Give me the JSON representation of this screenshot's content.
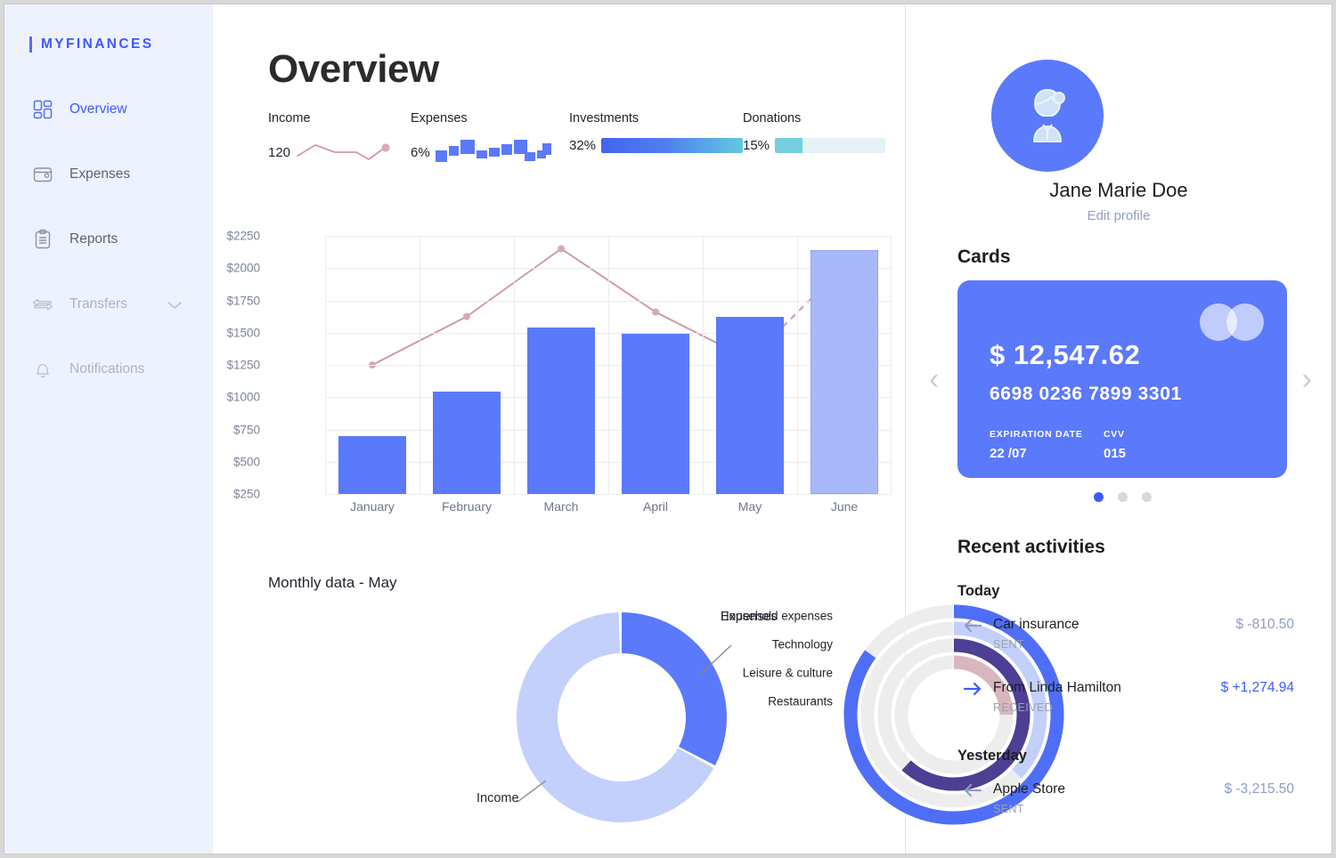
{
  "brand": {
    "name": "MYFINANCES"
  },
  "sidebar": {
    "items": [
      {
        "label": "Overview",
        "icon": "grid-icon",
        "state": "active"
      },
      {
        "label": "Expenses",
        "icon": "wallet-icon",
        "state": "normal"
      },
      {
        "label": "Reports",
        "icon": "clipboard-icon",
        "state": "normal"
      },
      {
        "label": "Transfers",
        "icon": "transfer-arrows-icon",
        "state": "muted",
        "chevron": "chevron-down-icon"
      },
      {
        "label": "Notifications",
        "icon": "bell-icon",
        "state": "muted"
      }
    ]
  },
  "header": {
    "title": "Overview"
  },
  "kpis": [
    {
      "title": "Income",
      "value": "120",
      "viz": "sparkline"
    },
    {
      "title": "Expenses",
      "value": "6%",
      "viz": "minibars"
    },
    {
      "title": "Investments",
      "value": "32%",
      "viz": "gradient-bar"
    },
    {
      "title": "Donations",
      "value": "15%",
      "viz": "progress-bar"
    }
  ],
  "colors": {
    "accent": "#3d5afe",
    "bar": "#5b79fb",
    "bar_projected": "#a8b8fb",
    "line": "#cf9aa8",
    "donut_expenses": "#5b79fb",
    "donut_income": "#c3d0fb",
    "sidebar_bg": "#eef2fe"
  },
  "chart_data": [
    {
      "type": "bar",
      "title": "",
      "categories": [
        "January",
        "February",
        "March",
        "April",
        "May",
        "June"
      ],
      "values": [
        700,
        1040,
        1540,
        1490,
        1620,
        2140
      ],
      "projected_index": 5,
      "series": [
        {
          "name": "trend",
          "type": "line",
          "values": [
            1250,
            1625,
            2150,
            1660,
            1290,
            2020
          ],
          "dashed_from": 4
        }
      ],
      "ylabel": "",
      "xlabel": "",
      "ylim": [
        250,
        2250
      ],
      "yticks": [
        "$2250",
        "$2000",
        "$1750",
        "$1500",
        "$1250",
        "$1000",
        "$750",
        "$500",
        "$250"
      ],
      "grid": true,
      "legend": "none"
    },
    {
      "type": "pie",
      "title": "Monthly data - May",
      "labels": [
        "Expenses",
        "Income"
      ],
      "values": [
        33,
        67
      ],
      "colors": [
        "#5b79fb",
        "#c3d0fb"
      ],
      "legend": "callout-labels"
    },
    {
      "type": "bar",
      "subtype": "radial",
      "title": "",
      "categories": [
        "Household expenses",
        "Technology",
        "Leisure & culture",
        "Restaurants"
      ],
      "values": [
        85,
        37,
        62,
        25
      ],
      "colors": [
        "#4f6ef7",
        "#c3d0fb",
        "#4c3f94",
        "#d9b6be"
      ],
      "track_color": "#ededee",
      "ylim": [
        0,
        100
      ],
      "legend": "left-labels"
    }
  ],
  "profile": {
    "name": "Jane Marie Doe",
    "edit_link": "Edit profile",
    "avatar_icon": "user-avatar-icon"
  },
  "cards_section": {
    "title": "Cards",
    "amount": "$ 12,547.62",
    "number": "6698 0236 7899 3301",
    "expiration_label": "EXPIRATION DATE",
    "expiration_value": "22 /07",
    "cvv_label": "CVV",
    "cvv_value": "015",
    "prev_icon": "chevron-left-icon",
    "next_icon": "chevron-right-icon",
    "total_dots": 3,
    "active_dot": 0
  },
  "activities": {
    "title": "Recent activities",
    "groups": [
      {
        "day": "Today",
        "items": [
          {
            "name": "Car insurance",
            "status": "SENT",
            "amount": "$ -810.50",
            "direction": "sent"
          },
          {
            "name": "From Linda Hamilton",
            "status": "RECEIVED",
            "amount": "$ +1,274.94",
            "direction": "received"
          }
        ]
      },
      {
        "day": "Yesterday",
        "items": [
          {
            "name": "Apple Store",
            "status": "SENT",
            "amount": "$ -3,215.50",
            "direction": "sent"
          }
        ]
      }
    ]
  }
}
